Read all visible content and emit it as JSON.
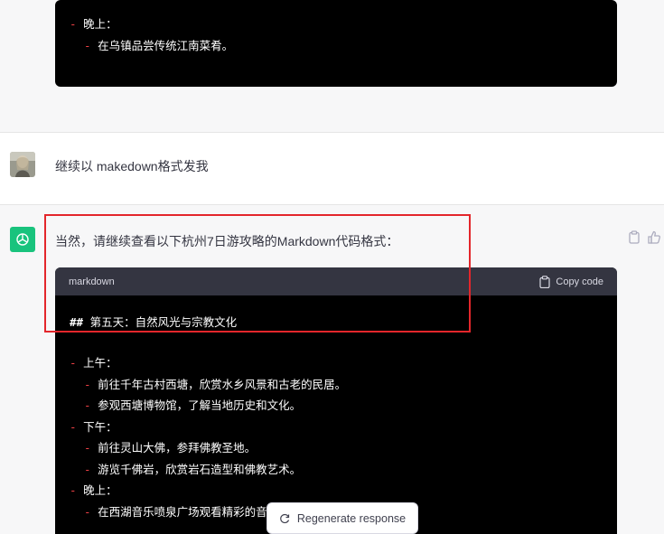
{
  "top_code": {
    "lines": [
      {
        "dash": "-",
        "text": "晚上："
      },
      {
        "dash": "-",
        "text": "在乌镇品尝传统江南菜肴。"
      }
    ]
  },
  "user_message": {
    "text": "继续以 makedown格式发我",
    "avatar_icon": "user-avatar"
  },
  "assistant_message": {
    "intro": "当然，请继续查看以下杭州7日游攻略的Markdown代码格式：",
    "avatar_icon": "openai-logo-icon",
    "code": {
      "language": "markdown",
      "copy_label": "Copy code",
      "heading_marker": "##",
      "heading_text": "第五天：自然风光与宗教文化",
      "lines": [
        {
          "indent": 0,
          "dash": "-",
          "text": "上午："
        },
        {
          "indent": 1,
          "dash": "-",
          "text": "前往千年古村西塘，欣赏水乡风景和古老的民居。"
        },
        {
          "indent": 1,
          "dash": "-",
          "text": "参观西塘博物馆，了解当地历史和文化。"
        },
        {
          "indent": 0,
          "dash": "-",
          "text": "下午："
        },
        {
          "indent": 1,
          "dash": "-",
          "text": "前往灵山大佛，参拜佛教圣地。"
        },
        {
          "indent": 1,
          "dash": "-",
          "text": "游览千佛岩，欣赏岩石造型和佛教艺术。"
        },
        {
          "indent": 0,
          "dash": "-",
          "text": "晚上："
        },
        {
          "indent": 1,
          "dash": "-",
          "text": "在西湖音乐喷泉广场观看精彩的音乐喷泉表演。"
        }
      ]
    }
  },
  "regenerate": {
    "label": "Regenerate response"
  },
  "colors": {
    "accent": "#19c37d",
    "highlight": "#e3262b",
    "code_bg": "#000000",
    "code_header": "#343541"
  }
}
